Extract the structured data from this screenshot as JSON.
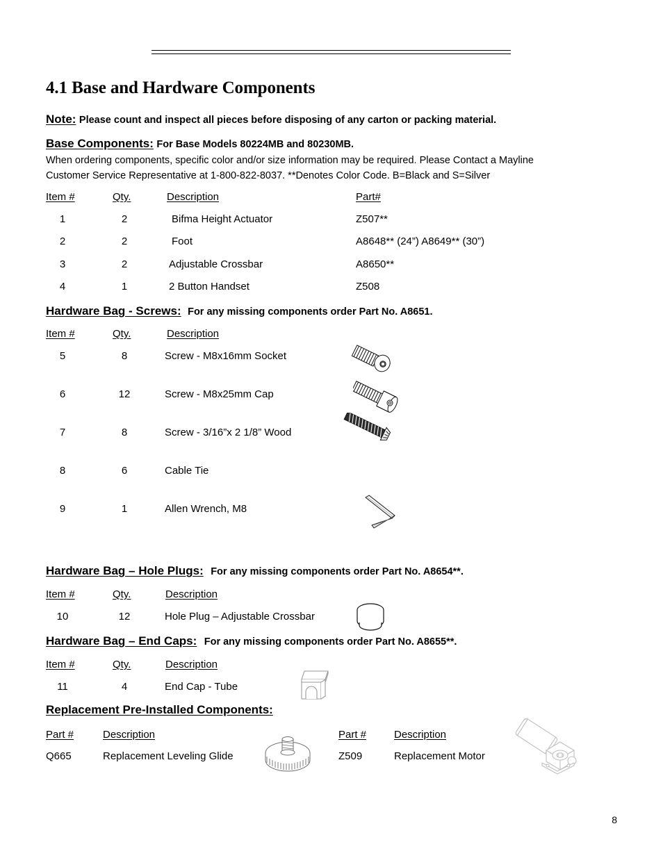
{
  "document": {
    "section_number_title": "4.1 Base and Hardware Components",
    "page_number": "8"
  },
  "note": {
    "label": "Note:",
    "text": "Please count and inspect all pieces before disposing of any carton or packing material."
  },
  "base_components": {
    "label": "Base Components:",
    "models_note": "For Base Models 80224MB and 80230MB.",
    "ordering_line_1": "When ordering components, specific color and/or size information may be required. Please Contact a Mayline",
    "ordering_line_2": "Customer Service Representative at 1-800-822-8037.  **Denotes Color Code. B=Black and S=Silver",
    "headers": {
      "item": "Item #",
      "qty": "Qty.",
      "description": "Description",
      "part": "Part#"
    },
    "rows": [
      {
        "item": "1",
        "qty": "2",
        "description": "Bifma Height Actuator",
        "part": "Z507**"
      },
      {
        "item": "2",
        "qty": "2",
        "description": "Foot",
        "part": "A8648** (24”) A8649** (30”)"
      },
      {
        "item": "3",
        "qty": "2",
        "description": "Adjustable Crossbar",
        "part": "A8650**"
      },
      {
        "item": "4",
        "qty": "1",
        "description": "2 Button Handset",
        "part": "Z508"
      }
    ]
  },
  "hardware_bag_screws": {
    "label": "Hardware Bag - Screws:",
    "order_note": "For any missing components order Part No. A8651.",
    "headers": {
      "item": "Item #",
      "qty": "Qty.",
      "description": "Description"
    },
    "rows": [
      {
        "item": "5",
        "qty": "8",
        "description": "Screw - M8x16mm Socket",
        "icon": "socket-screw-icon"
      },
      {
        "item": "6",
        "qty": "12",
        "description": "Screw - M8x25mm Cap",
        "icon": "cap-screw-icon"
      },
      {
        "item": "7",
        "qty": "8",
        "description": "Screw - 3/16”x 2 1/8” Wood",
        "icon": "wood-screw-icon"
      },
      {
        "item": "8",
        "qty": "6",
        "description": "Cable Tie",
        "icon": ""
      },
      {
        "item": "9",
        "qty": "1",
        "description": "Allen Wrench, M8",
        "icon": "allen-wrench-icon"
      }
    ]
  },
  "hardware_bag_hole_plugs": {
    "label": "Hardware Bag – Hole Plugs:",
    "order_note": "For any missing components order Part No. A8654**.",
    "headers": {
      "item": "Item #",
      "qty": "Qty.",
      "description": "Description"
    },
    "rows": [
      {
        "item": "10",
        "qty": "12",
        "description": "Hole Plug – Adjustable Crossbar",
        "icon": "hole-plug-icon"
      }
    ]
  },
  "hardware_bag_end_caps": {
    "label": "Hardware Bag – End Caps:",
    "order_note": "For any missing components order Part No. A8655**.",
    "headers": {
      "item": "Item #",
      "qty": "Qty.",
      "description": "Description"
    },
    "rows": [
      {
        "item": "11",
        "qty": "4",
        "description": "End Cap - Tube",
        "icon": "end-cap-icon"
      }
    ]
  },
  "replacement_components": {
    "label": "Replacement Pre-Installed Components:",
    "headers": {
      "part_left": "Part #",
      "description_left": "Description",
      "part_right": "Part #",
      "description_right": "Description"
    },
    "rows": [
      {
        "part_left": "Q665",
        "description_left": "Replacement Leveling Glide",
        "icon_left": "leveling-glide-icon",
        "part_right": "Z509",
        "description_right": "Replacement Motor",
        "icon_right": "motor-icon"
      }
    ]
  },
  "colors": {
    "text": "#000000",
    "background": "#ffffff",
    "artwork_line": "#1a1a1a",
    "artwork_light": "#b5b5b5"
  }
}
